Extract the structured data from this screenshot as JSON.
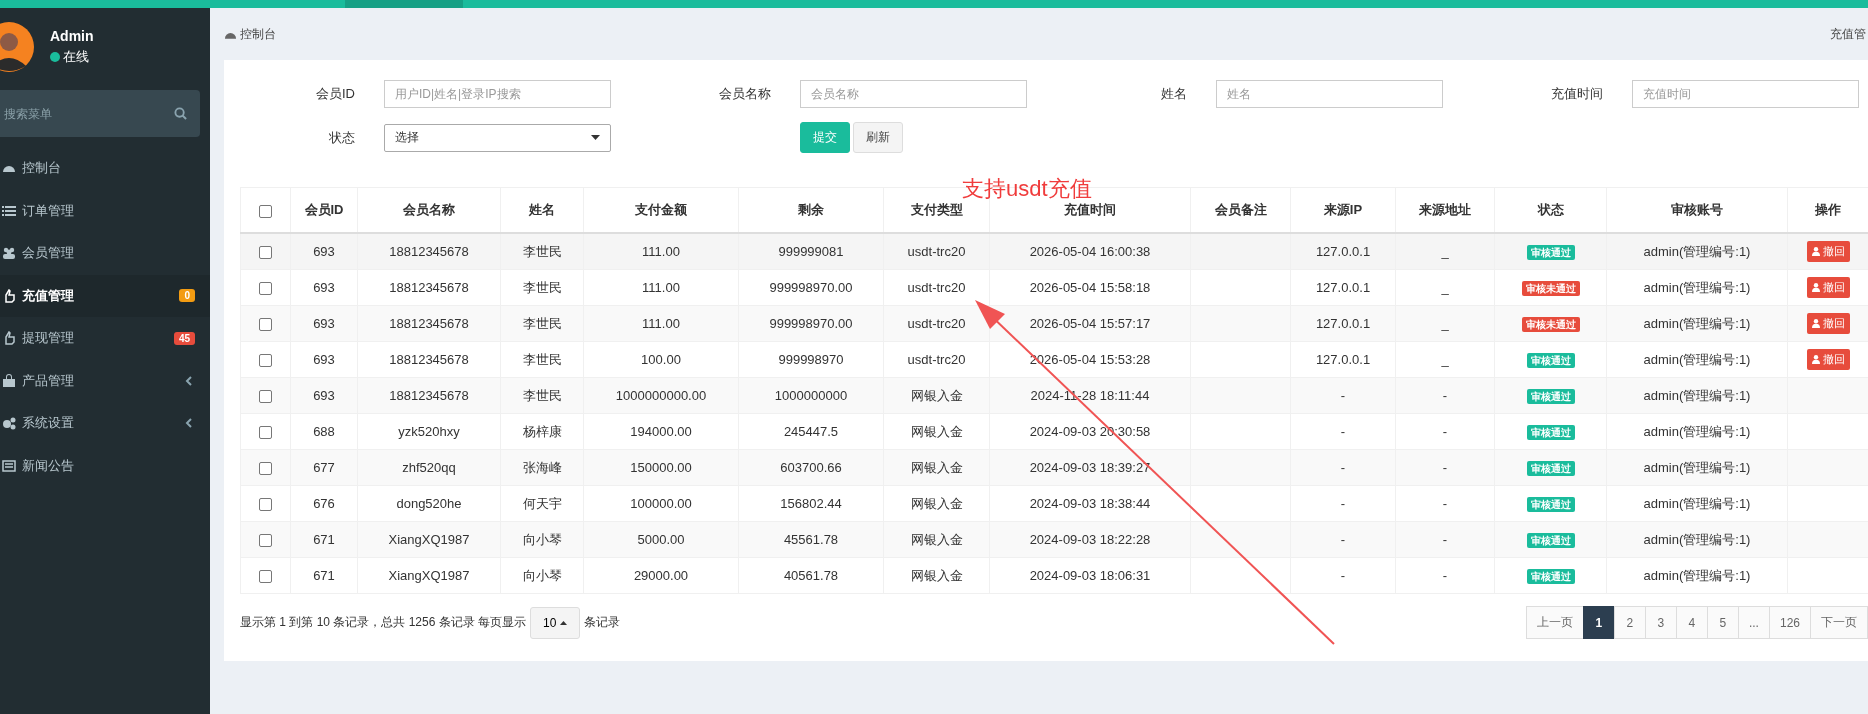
{
  "sidebar": {
    "user": {
      "name": "Admin",
      "status": "在线"
    },
    "search": {
      "placeholder": "搜索菜单"
    },
    "items": [
      {
        "label": "控制台",
        "selected": false,
        "expandable": false
      },
      {
        "label": "订单管理",
        "selected": false,
        "expandable": false
      },
      {
        "label": "会员管理",
        "selected": false,
        "expandable": false
      },
      {
        "label": "充值管理",
        "selected": true,
        "expandable": false,
        "badge": {
          "text": "0",
          "color": "#f39c12"
        }
      },
      {
        "label": "提现管理",
        "selected": false,
        "expandable": false,
        "badge": {
          "text": "45",
          "color": "#e74c3c"
        }
      },
      {
        "label": "产品管理",
        "selected": false,
        "expandable": true
      },
      {
        "label": "系统设置",
        "selected": false,
        "expandable": true
      },
      {
        "label": "新闻公告",
        "selected": false,
        "expandable": false
      }
    ]
  },
  "breadcrumb": {
    "current": "控制台",
    "right": "充值管"
  },
  "filters": [
    {
      "label": "会员ID",
      "kind": "input",
      "placeholder": "用户ID|姓名|登录IP搜索"
    },
    {
      "label": "会员名称",
      "kind": "input",
      "placeholder": "会员名称"
    },
    {
      "label": "姓名",
      "kind": "input",
      "placeholder": "姓名"
    },
    {
      "label": "充值时间",
      "kind": "input",
      "placeholder": "充值时间"
    },
    {
      "label": "状态",
      "kind": "select",
      "value": "选择"
    }
  ],
  "buttons": [
    {
      "label": "提交",
      "kind": "primary"
    },
    {
      "label": "刷新",
      "kind": "default"
    }
  ],
  "table": {
    "select_all": {
      "checked": false
    },
    "columns": [
      "会员ID",
      "会员名称",
      "姓名",
      "支付金额",
      "剩余",
      "支付类型",
      "充值时间",
      "会员备注",
      "来源IP",
      "来源地址",
      "状态",
      "审核账号",
      "操作"
    ],
    "rows": [
      {
        "checked": false,
        "member_id": "693",
        "member_name": "18812345678",
        "name": "李世民",
        "amount": "111.00",
        "remaining": "999999081",
        "pay_type": "usdt-trc20",
        "time": "2026-05-04 16:00:38",
        "source_ip": "127.0.0.1",
        "source_address": "_",
        "status": {
          "text": "审核通过",
          "kind": "approved"
        },
        "auditor": "admin(管理编号:1)",
        "action": "撤回"
      },
      {
        "checked": false,
        "member_id": "693",
        "member_name": "18812345678",
        "name": "李世民",
        "amount": "111.00",
        "remaining": "999998970.00",
        "pay_type": "usdt-trc20",
        "time": "2026-05-04 15:58:18",
        "source_ip": "127.0.0.1",
        "source_address": "_",
        "status": {
          "text": "审核未通过",
          "kind": "rejected"
        },
        "auditor": "admin(管理编号:1)",
        "action": "撤回"
      },
      {
        "checked": false,
        "member_id": "693",
        "member_name": "18812345678",
        "name": "李世民",
        "amount": "111.00",
        "remaining": "999998970.00",
        "pay_type": "usdt-trc20",
        "time": "2026-05-04 15:57:17",
        "source_ip": "127.0.0.1",
        "source_address": "_",
        "status": {
          "text": "审核未通过",
          "kind": "rejected"
        },
        "auditor": "admin(管理编号:1)",
        "action": "撤回"
      },
      {
        "checked": false,
        "member_id": "693",
        "member_name": "18812345678",
        "name": "李世民",
        "amount": "100.00",
        "remaining": "999998970",
        "pay_type": "usdt-trc20",
        "time": "2026-05-04 15:53:28",
        "source_ip": "127.0.0.1",
        "source_address": "_",
        "status": {
          "text": "审核通过",
          "kind": "approved"
        },
        "auditor": "admin(管理编号:1)",
        "action": "撤回"
      },
      {
        "checked": false,
        "member_id": "693",
        "member_name": "18812345678",
        "name": "李世民",
        "amount": "1000000000.00",
        "remaining": "1000000000",
        "pay_type": "网银入金",
        "time": "2024-11-28 18:11:44",
        "source_ip": "-",
        "source_address": "-",
        "status": {
          "text": "审核通过",
          "kind": "approved"
        },
        "auditor": "admin(管理编号:1)"
      },
      {
        "checked": false,
        "member_id": "688",
        "member_name": "yzk520hxy",
        "name": "杨梓康",
        "amount": "194000.00",
        "remaining": "245447.5",
        "pay_type": "网银入金",
        "time": "2024-09-03 20:30:58",
        "source_ip": "-",
        "source_address": "-",
        "status": {
          "text": "审核通过",
          "kind": "approved"
        },
        "auditor": "admin(管理编号:1)"
      },
      {
        "checked": false,
        "member_id": "677",
        "member_name": "zhf520qq",
        "name": "张海峰",
        "amount": "150000.00",
        "remaining": "603700.66",
        "pay_type": "网银入金",
        "time": "2024-09-03 18:39:27",
        "source_ip": "-",
        "source_address": "-",
        "status": {
          "text": "审核通过",
          "kind": "approved"
        },
        "auditor": "admin(管理编号:1)"
      },
      {
        "checked": false,
        "member_id": "676",
        "member_name": "dong520he",
        "name": "何天宇",
        "amount": "100000.00",
        "remaining": "156802.44",
        "pay_type": "网银入金",
        "time": "2024-09-03 18:38:44",
        "source_ip": "-",
        "source_address": "-",
        "status": {
          "text": "审核通过",
          "kind": "approved"
        },
        "auditor": "admin(管理编号:1)"
      },
      {
        "checked": false,
        "member_id": "671",
        "member_name": "XiangXQ1987",
        "name": "向小琴",
        "amount": "5000.00",
        "remaining": "45561.78",
        "pay_type": "网银入金",
        "time": "2024-09-03 18:22:28",
        "source_ip": "-",
        "source_address": "-",
        "status": {
          "text": "审核通过",
          "kind": "approved"
        },
        "auditor": "admin(管理编号:1)"
      },
      {
        "checked": false,
        "member_id": "671",
        "member_name": "XiangXQ1987",
        "name": "向小琴",
        "amount": "29000.00",
        "remaining": "40561.78",
        "pay_type": "网银入金",
        "time": "2024-09-03 18:06:31",
        "source_ip": "-",
        "source_address": "-",
        "status": {
          "text": "审核通过",
          "kind": "approved"
        },
        "auditor": "admin(管理编号:1)"
      }
    ]
  },
  "footer": {
    "summary": "显示第 1 到第 10 条记录，总共 1256 条记录 每页显示",
    "page_size": "10",
    "suffix": "条记录"
  },
  "pagination": [
    {
      "label": "上一页",
      "selected": false
    },
    {
      "label": "1",
      "selected": true
    },
    {
      "label": "2",
      "selected": false
    },
    {
      "label": "3",
      "selected": false
    },
    {
      "label": "4",
      "selected": false
    },
    {
      "label": "5",
      "selected": false
    },
    {
      "label": "...",
      "selected": false
    },
    {
      "label": "126",
      "selected": false
    },
    {
      "label": "下一页",
      "selected": false
    }
  ],
  "annotation": {
    "text": "支持usdt充值"
  }
}
